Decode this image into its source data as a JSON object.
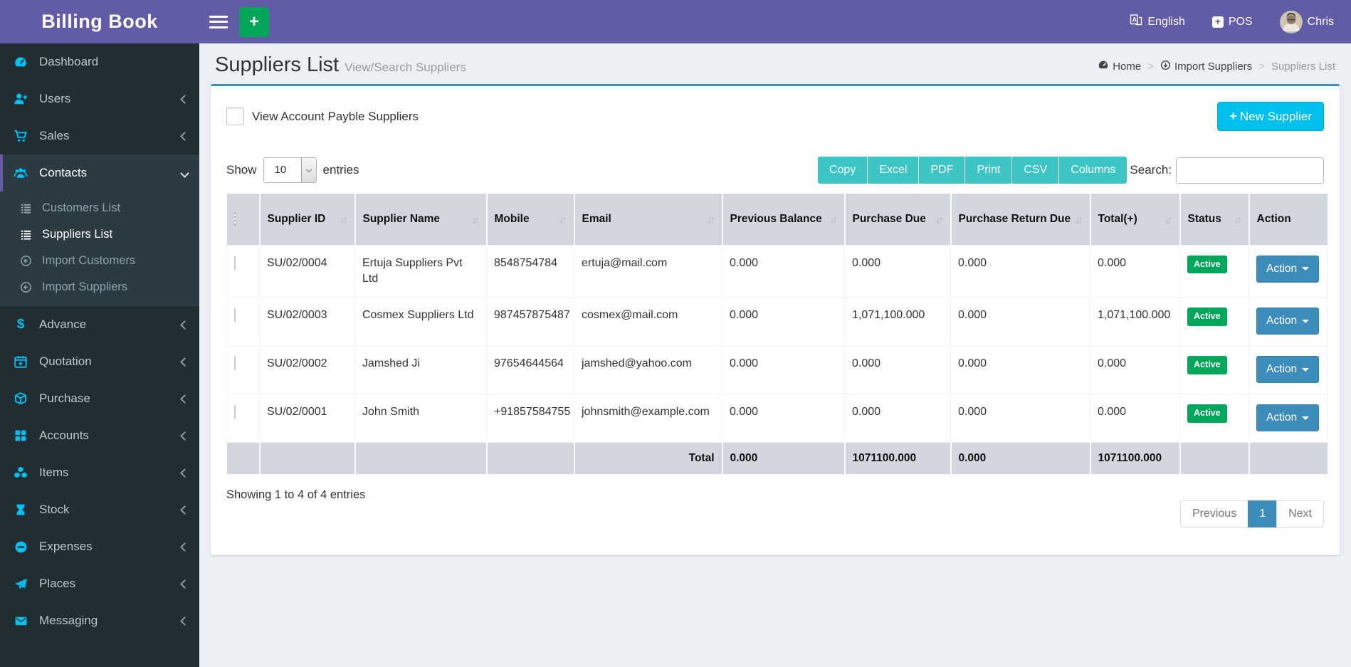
{
  "brand": {
    "title": "Billing Book"
  },
  "navbar": {
    "language": "English",
    "pos_label": "POS",
    "username": "Chris"
  },
  "sidebar": {
    "items": [
      {
        "label": "Dashboard",
        "icon": "dashboard-icon"
      },
      {
        "label": "Users",
        "icon": "user-plus-icon"
      },
      {
        "label": "Sales",
        "icon": "cart-icon"
      },
      {
        "label": "Contacts",
        "icon": "users-icon",
        "active": true,
        "expanded": true
      },
      {
        "label": "Advance",
        "icon": "dollar-icon"
      },
      {
        "label": "Quotation",
        "icon": "calendar-plus-icon"
      },
      {
        "label": "Purchase",
        "icon": "cube-icon"
      },
      {
        "label": "Accounts",
        "icon": "grid-icon"
      },
      {
        "label": "Items",
        "icon": "cubes-icon"
      },
      {
        "label": "Stock",
        "icon": "hourglass-icon"
      },
      {
        "label": "Expenses",
        "icon": "minus-circle-icon"
      },
      {
        "label": "Places",
        "icon": "paper-plane-icon"
      },
      {
        "label": "Messaging",
        "icon": "envelope-icon"
      }
    ],
    "submenu": [
      {
        "label": "Customers List",
        "icon": "list-icon"
      },
      {
        "label": "Suppliers List",
        "icon": "list-icon",
        "active": true
      },
      {
        "label": "Import Customers",
        "icon": "import-icon"
      },
      {
        "label": "Import Suppliers",
        "icon": "import-icon"
      }
    ]
  },
  "page": {
    "title": "Suppliers List",
    "subtitle": "View/Search Suppliers",
    "breadcrumb": [
      "Home",
      "Import Suppliers",
      "Suppliers List"
    ]
  },
  "toolbar": {
    "payble_label": "View Account Payble Suppliers",
    "new_supplier_label": "New Supplier",
    "show_label": "Show",
    "page_length": "10",
    "entries_label": "entries",
    "export_buttons": [
      "Copy",
      "Excel",
      "PDF",
      "Print",
      "CSV",
      "Columns"
    ],
    "search_label": "Search:"
  },
  "table": {
    "headers": [
      "Supplier ID",
      "Supplier Name",
      "Mobile",
      "Email",
      "Previous Balance",
      "Purchase Due",
      "Purchase Return Due",
      "Total(+)",
      "Status",
      "Action"
    ],
    "rows": [
      {
        "supplier_id": "SU/02/0004",
        "name": "Ertuja Suppliers Pvt Ltd",
        "mobile": "8548754784",
        "email": "ertuja@mail.com",
        "previous_balance": "0.000",
        "purchase_due": "0.000",
        "purchase_return_due": "0.000",
        "total": "0.000",
        "status": "Active",
        "action_label": "Action"
      },
      {
        "supplier_id": "SU/02/0003",
        "name": "Cosmex Suppliers Ltd",
        "mobile": "987457875487",
        "email": "cosmex@mail.com",
        "previous_balance": "0.000",
        "purchase_due": "1,071,100.000",
        "purchase_return_due": "0.000",
        "total": "1,071,100.000",
        "status": "Active",
        "action_label": "Action"
      },
      {
        "supplier_id": "SU/02/0002",
        "name": "Jamshed Ji",
        "mobile": "97654644564",
        "email": "jamshed@yahoo.com",
        "previous_balance": "0.000",
        "purchase_due": "0.000",
        "purchase_return_due": "0.000",
        "total": "0.000",
        "status": "Active",
        "action_label": "Action"
      },
      {
        "supplier_id": "SU/02/0001",
        "name": "John Smith",
        "mobile": "+91857584755",
        "email": "johnsmith@example.com",
        "previous_balance": "0.000",
        "purchase_due": "0.000",
        "purchase_return_due": "0.000",
        "total": "0.000",
        "status": "Active",
        "action_label": "Action"
      }
    ],
    "footer": {
      "label": "Total",
      "previous_balance": "0.000",
      "purchase_due": "1071100.000",
      "purchase_return_due": "0.000",
      "total": "1071100.000"
    },
    "summary": "Showing 1 to 4 of 4 entries"
  },
  "pagination": {
    "previous": "Previous",
    "current": "1",
    "next": "Next"
  },
  "colors": {
    "accent_purple": "#605ca8",
    "info_cyan": "#00c0ef",
    "success_green": "#00a65a",
    "teal_buttons": "#3cc5c5",
    "primary_blue": "#3c8dbc",
    "sidebar_dark": "#222d32",
    "table_header": "#d2d6de"
  }
}
